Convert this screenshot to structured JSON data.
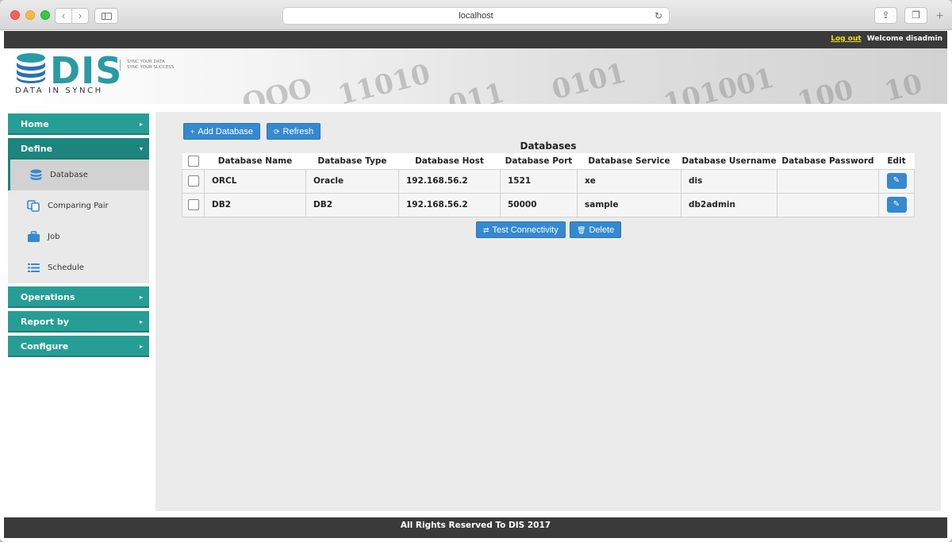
{
  "browser": {
    "url": "localhost",
    "back": "‹",
    "forward": "›",
    "reload": "↻",
    "share": "⇪",
    "tabs": "❐",
    "new_tab": "+"
  },
  "topbar": {
    "logout": "Log out",
    "welcome": "Welcome disadmin"
  },
  "logo": {
    "name": "DIS",
    "tagline_1": "SYNC YOUR DATA",
    "tagline_2": "SYNC YOUR SUCCESS",
    "subtitle": "DATA IN SYNCH"
  },
  "colors": {
    "accent": "#269e95",
    "button": "#3589cf",
    "bar": "#3a3a3a"
  },
  "nav": {
    "home": "Home",
    "define": "Define",
    "database": "Database",
    "comparing_pair": "Comparing Pair",
    "job": "Job",
    "schedule": "Schedule",
    "operations": "Operations",
    "report_by": "Report by",
    "configure": "Configure",
    "arrow_right": "▸",
    "arrow_down": "▾"
  },
  "toolbar": {
    "add_icon": "+",
    "add": "Add Database",
    "refresh_icon": "⟳",
    "refresh": "Refresh",
    "test_icon": "⇄",
    "test": "Test Connectivity",
    "delete_icon": "🗑",
    "delete": "Delete"
  },
  "table": {
    "title": "Databases",
    "headers": [
      "Database Name",
      "Database Type",
      "Database Host",
      "Database Port",
      "Database Service",
      "Database Username",
      "Database Password",
      "Edit"
    ],
    "rows": [
      {
        "name": "ORCL",
        "type": "Oracle",
        "host": "192.168.56.2",
        "port": "1521",
        "service": "xe",
        "username": "dis",
        "password": "",
        "edit": "✎"
      },
      {
        "name": "DB2",
        "type": "DB2",
        "host": "192.168.56.2",
        "port": "50000",
        "service": "sample",
        "username": "db2admin",
        "password": "",
        "edit": "✎"
      }
    ]
  },
  "footer": "All Rights Reserved To DIS 2017"
}
